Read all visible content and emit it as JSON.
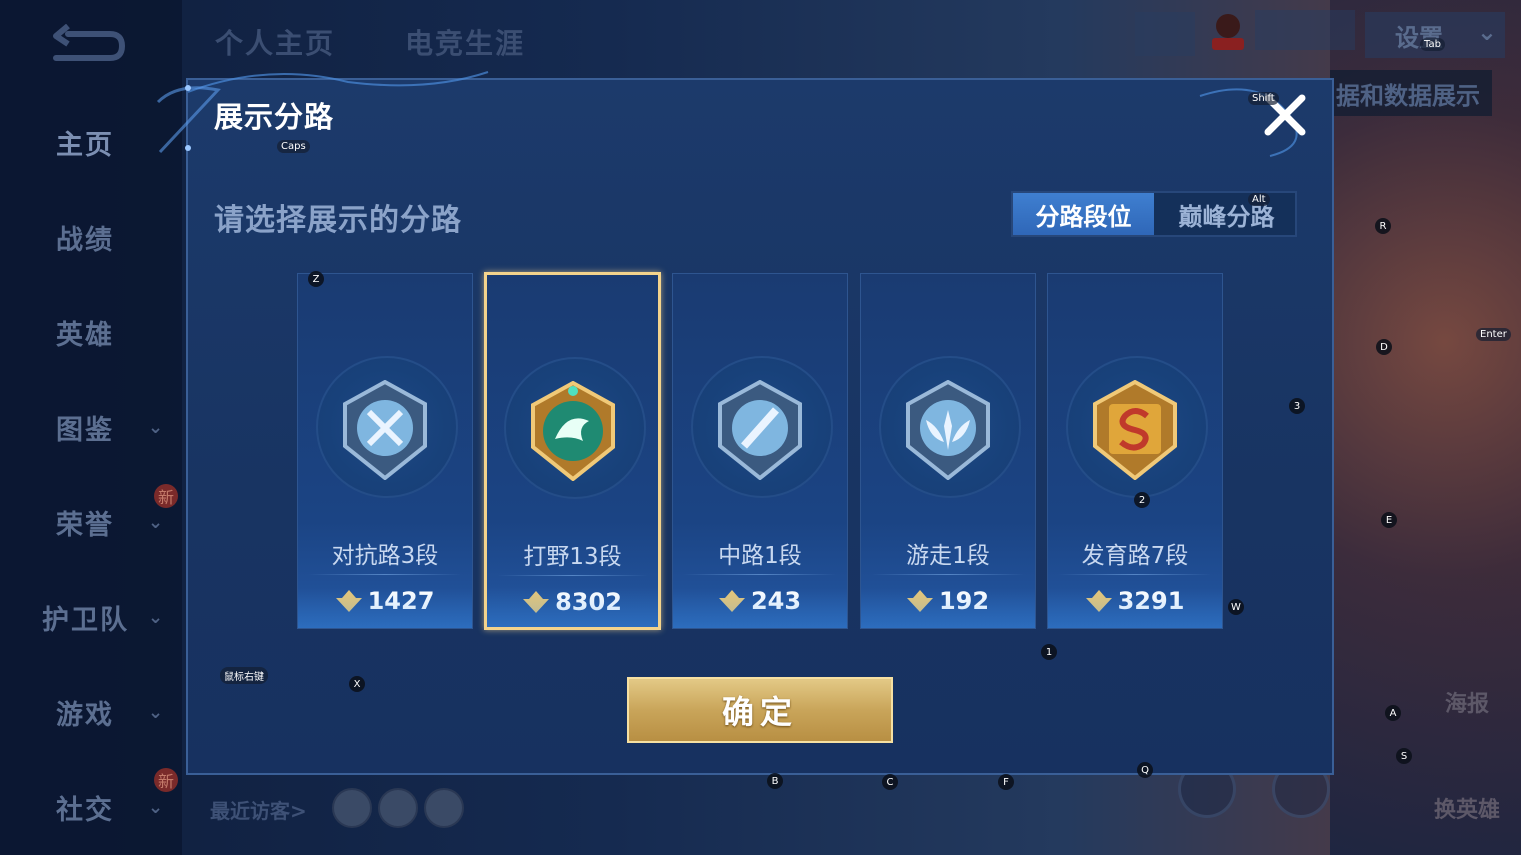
{
  "sidebar": {
    "items": [
      {
        "label": "主页",
        "active": true
      },
      {
        "label": "战绩"
      },
      {
        "label": "英雄"
      },
      {
        "label": "图鉴"
      },
      {
        "label": "荣誉",
        "badge": "新"
      },
      {
        "label": "护卫队"
      },
      {
        "label": "游戏"
      },
      {
        "label": "社交",
        "badge": "新"
      }
    ]
  },
  "header": {
    "tabs": [
      "个人主页",
      "电竞生涯"
    ],
    "settings_label": "设置",
    "behind_label": "据和数据展示"
  },
  "visitors": {
    "label": "最近访客>"
  },
  "right_buttons": {
    "poster": "海报",
    "change_hero": "换英雄"
  },
  "modal": {
    "title": "展示分路",
    "subtitle": "请选择展示的分路",
    "toggle": {
      "selected": "分路段位",
      "other": "巅峰分路"
    },
    "confirm_label": "确定",
    "lanes": [
      {
        "name": "对抗路3段",
        "score": "1427",
        "emblem": "sword-cross-emblem",
        "color": "#7fb6e0",
        "selected": false
      },
      {
        "name": "打野13段",
        "score": "8302",
        "emblem": "dragon-emblem",
        "color": "#2aa58a",
        "selected": true
      },
      {
        "name": "中路1段",
        "score": "243",
        "emblem": "staff-emblem",
        "color": "#7fb6e0",
        "selected": false
      },
      {
        "name": "游走1段",
        "score": "192",
        "emblem": "wing-emblem",
        "color": "#7fb6e0",
        "selected": false
      },
      {
        "name": "发育路7段",
        "score": "3291",
        "emblem": "bow-emblem",
        "color": "#e0a63a",
        "selected": false
      }
    ]
  },
  "key_hints": {
    "caps": "Caps",
    "shift": "Shift",
    "alt": "Alt",
    "tab": "Tab",
    "enter": "Enter",
    "mouse_right": "鼠标右键",
    "z": "Z",
    "x": "X",
    "b": "B",
    "c": "C",
    "f": "F",
    "q": "Q",
    "r": "R",
    "d": "D",
    "e": "E",
    "a": "A",
    "s": "S",
    "w": "W",
    "n1": "1",
    "n2": "2",
    "n3": "3"
  }
}
